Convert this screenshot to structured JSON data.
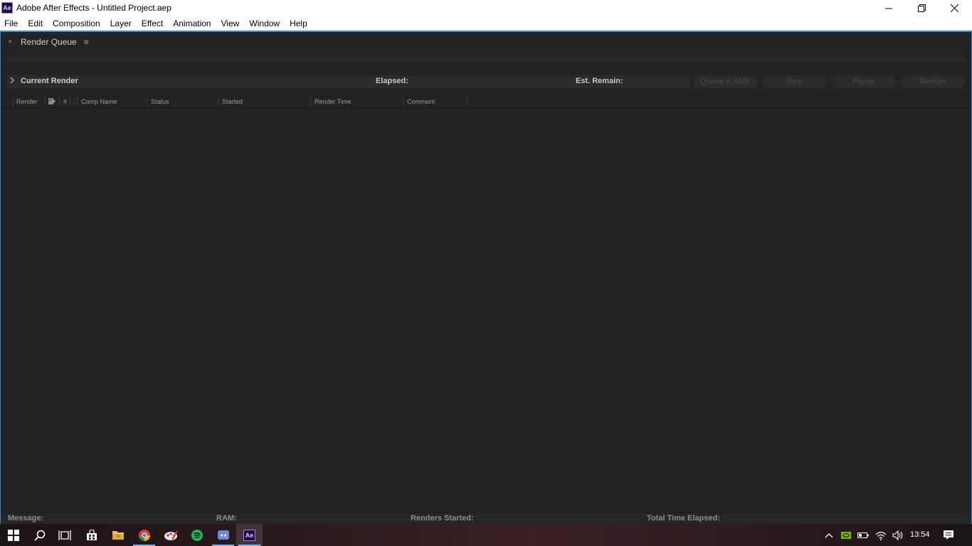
{
  "window": {
    "app_icon_text": "Ae",
    "title": "Adobe After Effects - Untitled Project.aep"
  },
  "menu": [
    "File",
    "Edit",
    "Composition",
    "Layer",
    "Effect",
    "Animation",
    "View",
    "Window",
    "Help"
  ],
  "panel": {
    "tab_label": "Render Queue",
    "close_glyph": "×",
    "menu_glyph": "≡"
  },
  "current_render": {
    "label": "Current Render",
    "elapsed_label": "Elapsed:",
    "remain_label": "Est. Remain:"
  },
  "buttons": {
    "queue_ame": "Queue in AME",
    "stop": "Stop",
    "pause": "Pause",
    "render": "Render"
  },
  "columns": {
    "render": "Render",
    "number": "#",
    "dot": ".",
    "comp_name": "Comp Name",
    "status": "Status",
    "started": "Started",
    "render_time": "Render Time",
    "comment": "Comment"
  },
  "footer": {
    "message": "Message:",
    "ram": "RAM:",
    "renders_started": "Renders Started:",
    "total_time": "Total Time Elapsed:"
  },
  "taskbar": {
    "ae_icon_text": "Ae",
    "clock": "13:54"
  },
  "colors": {
    "accent_frame": "#2d8ceb",
    "panel_bg": "#232323",
    "ae_purple": "#9a7cff"
  }
}
